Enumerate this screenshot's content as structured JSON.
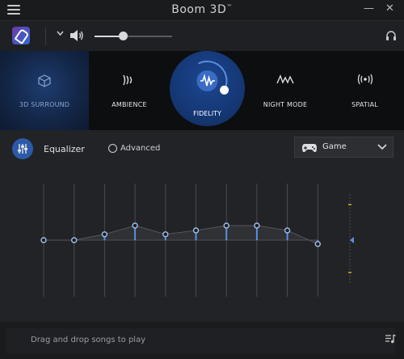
{
  "app": {
    "title": "Boom 3D",
    "title_mark": "™"
  },
  "window": {
    "minimize": "—",
    "close": "✕"
  },
  "toolbar": {
    "menu_icon": "hamburger-icon",
    "device_icon": "microphone-icon",
    "volume_level": 0.37,
    "headphone_icon": "headphone-icon"
  },
  "effects": [
    {
      "id": "3d-surround",
      "label": "3D SURROUND",
      "icon": "cube-icon",
      "active": false
    },
    {
      "id": "ambience",
      "label": "AMBIENCE",
      "icon": "wave-icon",
      "active": false
    },
    {
      "id": "fidelity",
      "label": "FIDELITY",
      "icon": "waveform-icon",
      "active": true,
      "intensity": 0.85
    },
    {
      "id": "night-mode",
      "label": "NIGHT MODE",
      "icon": "wave-line-icon",
      "active": false
    },
    {
      "id": "spatial",
      "label": "SPATIAL",
      "icon": "broadcast-icon",
      "active": false
    }
  ],
  "equalizer": {
    "title": "Equalizer",
    "advanced_label": "Advanced",
    "advanced_checked": false,
    "preset": "Game",
    "bands_count": 10,
    "band_levels": [
      0,
      0,
      0.3,
      0.75,
      0.3,
      0.5,
      0.75,
      0.75,
      0.5,
      -0.2
    ],
    "preamp_level": 0
  },
  "playlist": {
    "placeholder": "Drag and drop songs to play"
  },
  "colors": {
    "accent": "#5b8fe0",
    "active_bg": "#163a7a"
  }
}
